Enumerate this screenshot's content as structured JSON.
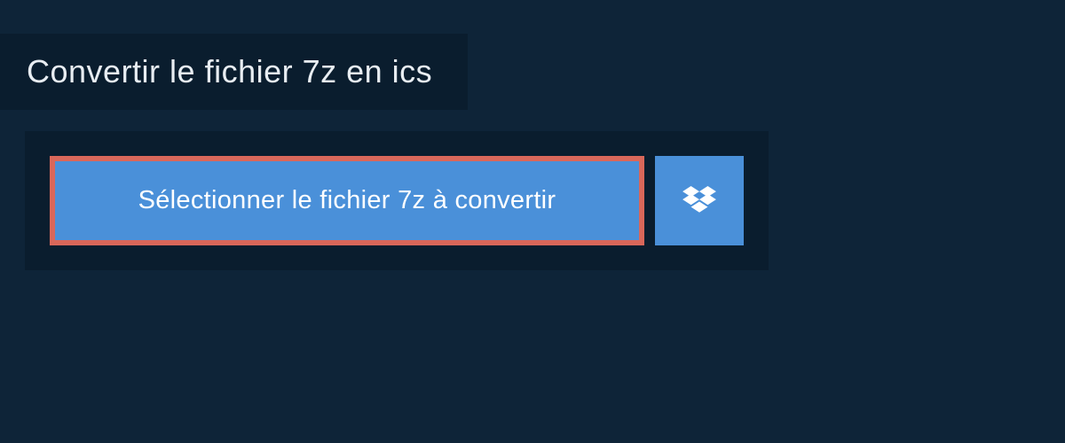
{
  "header": {
    "title": "Convertir le fichier 7z en ics"
  },
  "buttons": {
    "select_file_label": "Sélectionner le fichier 7z à convertir"
  },
  "colors": {
    "background": "#0e2438",
    "panel": "#0a1d2e",
    "button_primary": "#4a90d9",
    "button_border": "#d9675a",
    "text_light": "#e8edf2"
  }
}
